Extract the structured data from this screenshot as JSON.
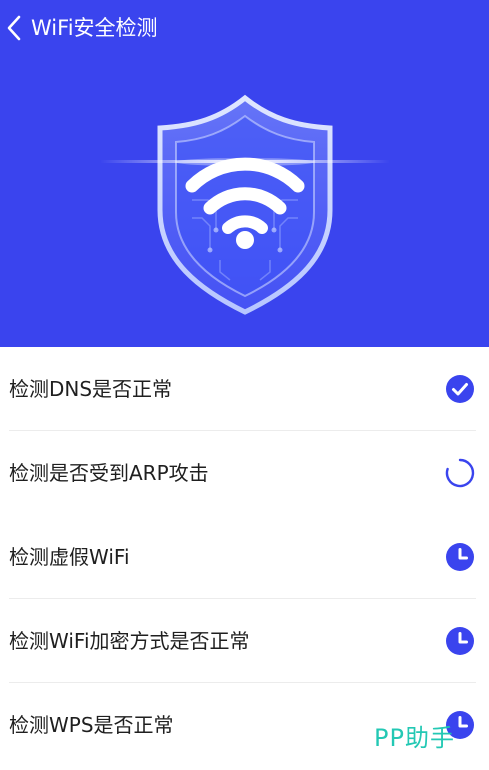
{
  "header": {
    "title": "WiFi安全检测",
    "back_icon": "chevron-left-icon"
  },
  "hero": {
    "background_color": "#3a44ee",
    "illustration_icon": "wifi-shield-icon"
  },
  "checks": [
    {
      "label": "检测DNS是否正常",
      "status": "done",
      "status_icon": "check-circle-icon"
    },
    {
      "label": "检测是否受到ARP攻击",
      "status": "in-progress",
      "status_icon": "spinner-icon"
    },
    {
      "label": "检测虚假WiFi",
      "status": "pending",
      "status_icon": "clock-icon"
    },
    {
      "label": "检测WiFi加密方式是否正常",
      "status": "pending",
      "status_icon": "clock-icon"
    },
    {
      "label": "检测WPS是否正常",
      "status": "pending",
      "status_icon": "clock-icon"
    }
  ],
  "watermark": {
    "text": "PP助手",
    "color": "#18c6b0"
  },
  "colors": {
    "accent": "#3a44ee",
    "text": "#1f1f1f",
    "divider": "#ececec"
  }
}
